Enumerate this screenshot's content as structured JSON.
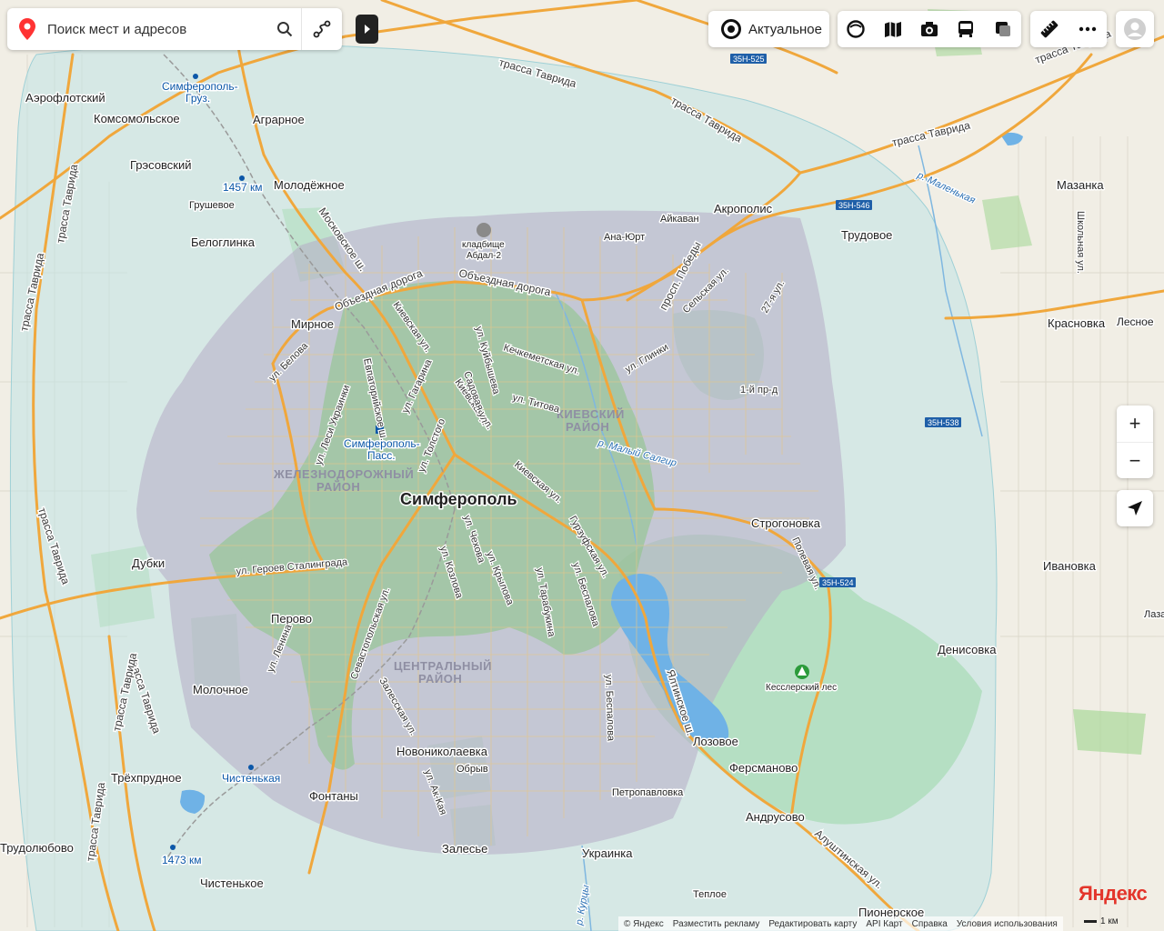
{
  "search": {
    "placeholder": "Поиск мест и адресов"
  },
  "toolbar": {
    "actual_label": "Актуальное"
  },
  "layers": [
    "panorama-icon",
    "layers-map-icon",
    "camera-icon",
    "bus-icon",
    "overlay-square-icon"
  ],
  "tools": [
    "ruler-icon",
    "more-dots-icon"
  ],
  "zoom": {
    "plus": "+",
    "minus": "−"
  },
  "map": {
    "city": "Симферополь",
    "districts": {
      "zhelezno_1": "ЖЕЛЕЗНОДОРОЖНЫЙ",
      "zhelezno_2": "РАЙОН",
      "kievsky_1": "КИЕВСКИЙ",
      "kievsky_2": "РАЙОН",
      "central_1": "ЦЕНТРАЛЬНЫЙ",
      "central_2": "РАЙОН"
    },
    "places": {
      "aeroflotsky": "Аэрофлотский",
      "komsomolskoe": "Комсомольское",
      "aerarnoe": "Аграрное",
      "grjasovsky": "Грэсовский",
      "molodyozhnoe": "Молодёжное",
      "grushevoe": "Грушевое",
      "beloglinka": "Белоглинка",
      "mirnoe": "Мирное",
      "dubki": "Дубки",
      "perovo": "Перово",
      "molochnoe": "Молочное",
      "tryohprudnoe": "Трёхпрудное",
      "fontany": "Фонтаны",
      "trudolyubovo": "Трудолюбово",
      "chistenkoe": "Чистенькое",
      "novonikolaevka": "Новониколаевка",
      "obryv": "Обрыв",
      "zalesye": "Залесье",
      "ukrainka": "Украинка",
      "teploe": "Теплое",
      "petropavlovka": "Петропавловка",
      "lozovoe": "Лозовое",
      "fersmanovo": "Ферсманово",
      "andrusovo": "Андрусово",
      "pionerskoe": "Пионерское",
      "denisovka": "Денисовка",
      "ivanovka": "Ивановка",
      "stroganovka": "Строгоновка",
      "trudovoe": "Трудовое",
      "akropolis": "Акрополис",
      "aykavan": "Айкаван",
      "ana_yurt": "Ана-Юрт",
      "mazanka": "Мазанка",
      "krasnovka": "Красновка",
      "lesnoe": "Лесное",
      "laza": "Лаза",
      "kesslersky_les": "Кесслерский лес",
      "cemetery_1": "кладбище",
      "cemetery_2": "Абдал-2"
    },
    "transit": {
      "simf_gruz_1": "Симферополь-",
      "simf_gruz_2": "Груз.",
      "simf_pass_1": "Симферополь-",
      "simf_pass_2": "Пасс.",
      "km1457": "1457 км",
      "km1473": "1473 км",
      "chistenkaya": "Чистенькая"
    },
    "roads": {
      "tavrida": "трасса Таврида",
      "obezdnaya": "Объездная дорога",
      "moskovskoe": "Московское ш.",
      "kievskaya": "Киевская ул.",
      "pr_pobedy": "просп. Победы",
      "evpatoriyskoe": "Евпаторийское ш.",
      "yaltinskoe": "Ялтинское ш.",
      "alushtinskaya": "Алуштинская ул.",
      "sevastopolskaya": "Севастопольская ул.",
      "geroev": "ул. Героев Сталинграда",
      "kuibysheva": "ул. Куйбышева",
      "kechkemetskaya": "Кечкеметская ул.",
      "sadovaya": "Садовая ул.",
      "titova": "ул. Титова",
      "gagarina": "ул. Гагарина",
      "lesi": "ул. Леси Украинки",
      "tolstogo": "ул. Толстого",
      "belova": "ул. Белова",
      "chekhova": "ул. Чехова",
      "kozlova": "ул. Козлова",
      "krylova": "ул. Крылова",
      "tarabukina": "ул. Тарабукина",
      "bespalova": "ул. Беспалова",
      "gurzufskaya": "Гурзуфская ул.",
      "lenina": "ул. Ленина",
      "zaleskaya": "Залесская ул.",
      "ak_kaya": "ул. Ак-Кая",
      "glinki": "ул. Глинки",
      "selskaya": "Сельская ул.",
      "ul27": "27-я ул.",
      "pr1": "1-й пр-д",
      "polevaya": "Полевая ул.",
      "shkolnaya": "Школьная ул.",
      "bespalova2": "ул. Беспалова"
    },
    "water": {
      "malenkaya": "р. Маленькая",
      "maly_salgir": "р. Малый Салгир",
      "kurtsy": "р. Курцы"
    },
    "shields": [
      "35Н-525",
      "35Н-546",
      "35Н-538",
      "35Н-524"
    ]
  },
  "footer": [
    "© Яндекс",
    "Разместить рекламу",
    "Редактировать карту",
    "API Карт",
    "Справка",
    "Условия использования"
  ],
  "scale": "1 км",
  "brand": "Яндекс"
}
